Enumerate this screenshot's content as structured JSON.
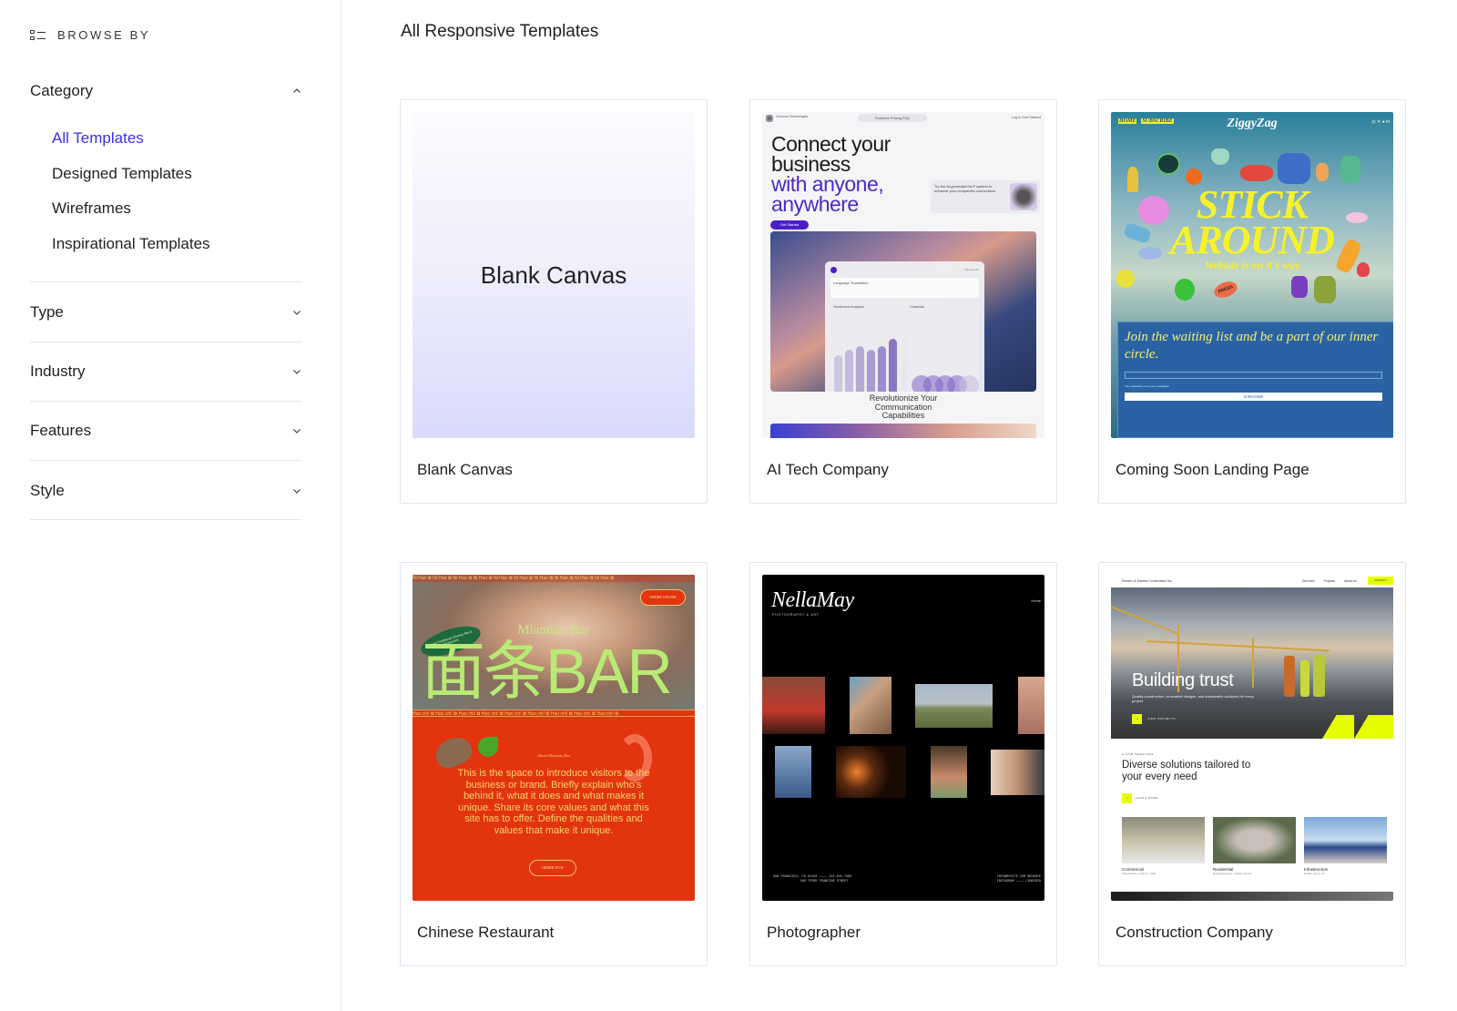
{
  "sidebar": {
    "browse_by": "BROWSE BY",
    "category": {
      "label": "Category",
      "expanded": true,
      "items": [
        {
          "label": "All Templates",
          "active": true
        },
        {
          "label": "Designed Templates",
          "active": false
        },
        {
          "label": "Wireframes",
          "active": false
        },
        {
          "label": "Inspirational Templates",
          "active": false
        }
      ]
    },
    "filters": [
      {
        "label": "Type",
        "expanded": false
      },
      {
        "label": "Industry",
        "expanded": false
      },
      {
        "label": "Features",
        "expanded": false
      },
      {
        "label": "Style",
        "expanded": false
      }
    ]
  },
  "main": {
    "title": "All Responsive Templates",
    "accent_color": "#3b2ded",
    "templates": [
      {
        "name": "Blank Canvas",
        "preview": {
          "heading": "Blank Canvas"
        }
      },
      {
        "name": "AI Tech Company",
        "preview": {
          "brand": "Cenvoso Technologies",
          "nav": "Features   Pricing   FAQ",
          "nav_right": "Log in   Get Started",
          "headline_1": "Connect your business",
          "headline_2": "with anyone, anywhere",
          "side_text": "Try the AI-generated NLP system to enhance your companies connections",
          "cta": "Get Started",
          "dash_account": "My Account",
          "dash_card_1": "Language Translation",
          "dash_card_2": "Sentiment Analysis",
          "dash_card_3": "Chatbots",
          "tagline": "Revolutionize Your Communication Capabilities"
        }
      },
      {
        "name": "Coming Soon Landing Page",
        "preview": {
          "nav_links": [
            "HOME",
            "SUBSCRIBE"
          ],
          "brand": "ZiggyZag",
          "headline": "STICK AROUND",
          "subline": "Website is on it's way",
          "join_text": "Join the waiting list and be a part of our inner circle.",
          "checkbox_text": "Yes, subscribe me to your newsletter",
          "subscribe": "SUBSCRIBE",
          "sticker_text": "FRESH"
        }
      },
      {
        "name": "Chinese Restaurant",
        "preview": {
          "ticker": "Ni Hao",
          "ticker_2": "Hao chi!",
          "order_online": "ORDER ONLINE",
          "bar_name": "Miantiao Bar",
          "headline": "面条BAR",
          "badge": "Not an Traditional Chinese Bar & Restaurant",
          "about_label": "About Miantiao Bar",
          "about_text": "This is the space to introduce visitors to the business or brand. Briefly explain who's behind it, what it does and what makes it unique. Share its core values and what this site has to offer.  Define the qualities and values that make it unique.",
          "order_now": "ORDER NOW"
        }
      },
      {
        "name": "Photographer",
        "preview": {
          "logo": "NellaMay",
          "logo_sub": "PHOTOGRAPHY & ART",
          "nav": "Home",
          "footer_left_1": "SAN FRANCISCO, CA 94158 ———— 123-456-7890",
          "footer_left_2": "500 TERRY FRANCINE STREET",
          "footer_right_1": "INFO@MYSITE.COM   BEHANCE",
          "footer_right_2": "INSTAGRAM ———— LINKEDIN"
        }
      },
      {
        "name": "Construction Company",
        "preview": {
          "brand": "Romero & Daniels Construction Inc.",
          "nav": [
            "Services",
            "Projects",
            "About us"
          ],
          "contact": "CONTACT",
          "headline": "Building trust",
          "description": "Quality construction, innovative designs, and sustainable solutions for every project",
          "view_projects": "VIEW PROJECTS",
          "services_label": "● OUR SERVICES",
          "services_title": "Diverse solutions tailored to your every need",
          "learn_more": "LEARN MORE",
          "services": [
            {
              "name": "Commercial",
              "desc": "Warehouses, outdoor, malls"
            },
            {
              "name": "Residential",
              "desc": "Neighborhoods, multiple homes"
            },
            {
              "name": "Infrastructure",
              "desc": "Roads, pipes, etc."
            }
          ]
        }
      }
    ]
  }
}
